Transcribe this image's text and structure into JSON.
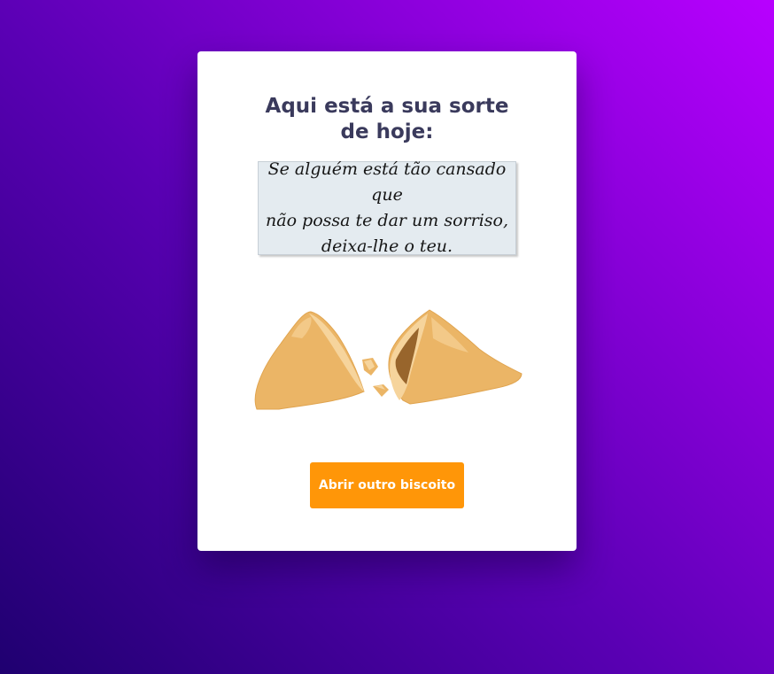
{
  "heading": "Aqui está a sua sorte de hoje:",
  "fortune": {
    "lines": [
      "Se alguém está tão cansado que",
      "não possa te dar um sorriso,",
      "deixa-lhe o teu."
    ]
  },
  "cookie_image": {
    "icon": "broken-fortune-cookie-icon"
  },
  "button": {
    "label": "Abrir outro biscoito",
    "color": "#ff9608"
  },
  "colors": {
    "background_start": "#1f0070",
    "background_end": "#b800ff",
    "heading": "#3a3a5c",
    "fortune_paper": "#e4ebf0"
  }
}
